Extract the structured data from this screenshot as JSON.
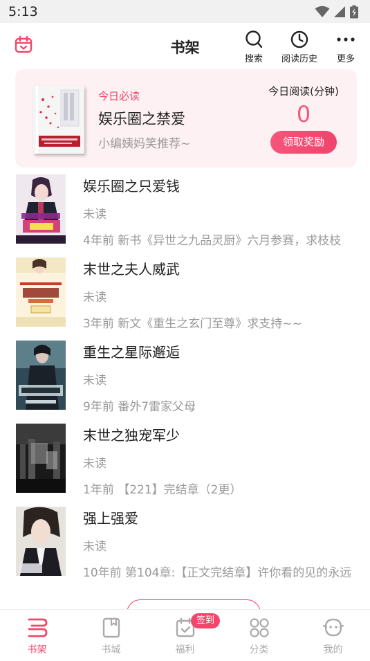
{
  "status_bar": {
    "time": "5:13"
  },
  "header": {
    "title": "书架",
    "actions": [
      {
        "label": "搜索",
        "icon": "search-icon"
      },
      {
        "label": "阅读历史",
        "icon": "clock-icon"
      },
      {
        "label": "更多",
        "icon": "more-icon"
      }
    ]
  },
  "daily": {
    "tag": "今日必读",
    "book_title": "娱乐圈之禁爱",
    "recommendation": "小编姨妈笑推荐~",
    "reading_label": "今日阅读(分钟)",
    "reading_minutes": "0",
    "reward_button": "领取奖励"
  },
  "books": [
    {
      "title": "娱乐圈之只爱钱",
      "status": "未读",
      "update": "4年前 新书《异世之九品灵厨》六月参赛，求枝枝"
    },
    {
      "title": "末世之夫人威武",
      "status": "未读",
      "update": "3年前 新文《重生之玄门至尊》求支持~~"
    },
    {
      "title": "重生之星际邂逅",
      "status": "未读",
      "update": "9年前 番外7雷家父母"
    },
    {
      "title": "末世之独宠军少",
      "status": "未读",
      "update": "1年前 【221】完结章（2更）"
    },
    {
      "title": "强上强爱",
      "status": "未读",
      "update": "10年前 第104章:【正文完结章】许你看的见的永远"
    }
  ],
  "nav": {
    "items": [
      {
        "label": "书架",
        "icon": "bookshelf-icon",
        "active": true
      },
      {
        "label": "书城",
        "icon": "bookstore-icon",
        "active": false
      },
      {
        "label": "福利",
        "icon": "calendar-check-icon",
        "active": false,
        "badge": "签到"
      },
      {
        "label": "分类",
        "icon": "category-icon",
        "active": false
      },
      {
        "label": "我的",
        "icon": "profile-icon",
        "active": false
      }
    ]
  },
  "colors": {
    "accent": "#f0476b",
    "card_bg": "#fdf1f3",
    "muted_text": "#999999",
    "inactive_nav": "#aaaaaa"
  }
}
